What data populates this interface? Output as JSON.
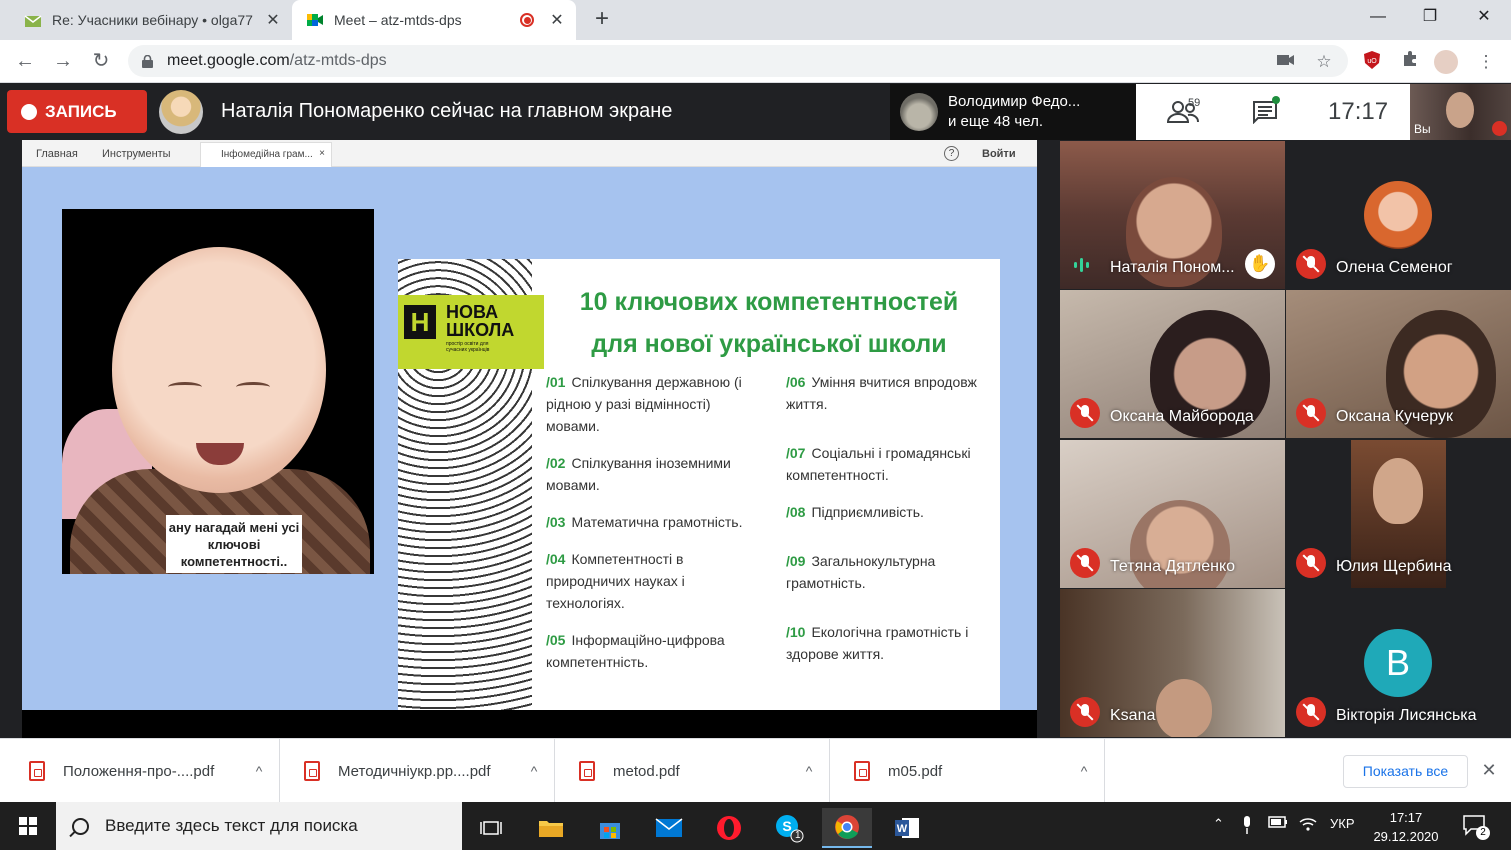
{
  "browser": {
    "tabs": [
      {
        "title": "Re: Учасники вебінару • olga77",
        "active": false
      },
      {
        "title": "Meet – atz-mtds-dps",
        "active": true
      }
    ],
    "new_tab": "+",
    "window_controls": {
      "minimize": "—",
      "restore": "❐",
      "close": "✕"
    },
    "url_host": "meet.google.com",
    "url_path": "/atz-mtds-dps"
  },
  "meet": {
    "record_label": "ЗАПИСЬ",
    "presenting_text": "Наталія Пономаренко сейчас на главном экране",
    "others_line1": "Володимир Федо...",
    "others_line2": "и еще 48 чел.",
    "people_count": "59",
    "clock": "17:17",
    "self_label": "Вы"
  },
  "presentation": {
    "toolbar": {
      "home": "Главная",
      "tools": "Инструменты",
      "tab": "Інфомедійна грам...",
      "tab_close": "×",
      "help": "?",
      "login": "Войти"
    },
    "caption": "ану нагадай мені усі ключові компетентності..",
    "logo_line1": "НОВА",
    "logo_line2": "ШКОЛА",
    "logo_sub": "простір освіти для сучасних українців",
    "slide_title_line1": "10 ключових компетентностей",
    "slide_title_line2": "для нової української школи",
    "competencies_left": [
      {
        "num": "/01",
        "text": "Спілкування державною (і рідною у разі відмінності) мовами."
      },
      {
        "num": "/02",
        "text": "Спілкування іноземними мовами."
      },
      {
        "num": "/03",
        "text": "Математична грамотність."
      },
      {
        "num": "/04",
        "text": "Компетентності в природничих науках і технологіях."
      },
      {
        "num": "/05",
        "text": "Інформаційно-цифрова компетентність."
      }
    ],
    "competencies_right": [
      {
        "num": "/06",
        "text": "Уміння вчитися впродовж життя."
      },
      {
        "num": "/07",
        "text": "Соціальні і громадянські компетентності."
      },
      {
        "num": "/08",
        "text": "Підприємливість."
      },
      {
        "num": "/09",
        "text": "Загальнокультурна грамотність."
      },
      {
        "num": "/10",
        "text": "Екологічна грамотність і здорове життя."
      }
    ]
  },
  "participants": [
    {
      "name": "Наталія Пономаренко",
      "display": "Наталія Поном...",
      "state": "speaking",
      "hand_raised": true
    },
    {
      "name": "Олена Семеног",
      "state": "muted"
    },
    {
      "name": "Оксана Майборода",
      "state": "muted"
    },
    {
      "name": "Оксана Кучерук",
      "state": "muted"
    },
    {
      "name": "Тетяна Дятленко",
      "state": "muted"
    },
    {
      "name": "Юлия Щербина",
      "state": "muted"
    },
    {
      "name": "Ksana",
      "state": "muted"
    },
    {
      "name": "Вікторія Лисянська",
      "state": "muted",
      "initial": "В"
    }
  ],
  "downloads": {
    "items": [
      "Положення-про-....pdf",
      "Методичніукр.рр....pdf",
      "metod.pdf",
      "m05.pdf"
    ],
    "chevron": "^",
    "show_all": "Показать все",
    "close": "✕"
  },
  "taskbar": {
    "search_placeholder": "Введите здесь текст для поиска",
    "language": "УКР",
    "time": "17:17",
    "date": "29.12.2020",
    "skype_badge": "1",
    "notification_badge": "2"
  },
  "colors": {
    "record": "#d93025",
    "accent_green": "#2e9b44",
    "logo_green": "#c1d72f",
    "slide_bg": "#a6c3ef"
  }
}
